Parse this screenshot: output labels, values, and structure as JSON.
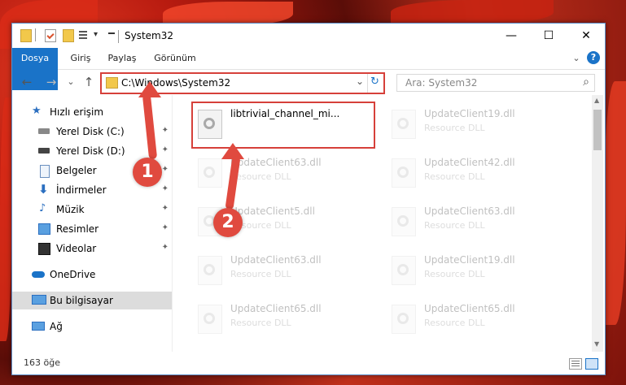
{
  "window": {
    "title": "System32",
    "minimize": "—",
    "maximize": "☐",
    "close": "✕"
  },
  "ribbon": {
    "tabs": [
      "Dosya",
      "Giriş",
      "Paylaş",
      "Görünüm"
    ],
    "chevron": "⌄",
    "help": "?"
  },
  "nav": {
    "back": "←",
    "forward": "→",
    "recent": "⌄",
    "up": "↑",
    "address": "C:\\Windows\\System32",
    "address_dropdown": "⌄",
    "refresh": "↻",
    "search_placeholder": "Ara: System32",
    "search_icon": "⌕"
  },
  "sidebar": {
    "items": [
      {
        "label": "Hızlı erişim",
        "pinned": false,
        "icon": "star-icon"
      },
      {
        "label": "Yerel Disk (C:)",
        "pinned": true,
        "icon": "drive-icon"
      },
      {
        "label": "Yerel Disk (D:)",
        "pinned": true,
        "icon": "drive-icon"
      },
      {
        "label": "Belgeler",
        "pinned": true,
        "icon": "document-icon"
      },
      {
        "label": "İndirmeler",
        "pinned": true,
        "icon": "download-icon"
      },
      {
        "label": "Müzik",
        "pinned": true,
        "icon": "music-icon"
      },
      {
        "label": "Resimler",
        "pinned": true,
        "icon": "pictures-icon"
      },
      {
        "label": "Videolar",
        "pinned": true,
        "icon": "video-icon"
      },
      {
        "label": "OneDrive",
        "pinned": false,
        "icon": "cloud-icon"
      },
      {
        "label": "Bu bilgisayar",
        "pinned": false,
        "icon": "computer-icon"
      },
      {
        "label": "Ağ",
        "pinned": false,
        "icon": "network-icon"
      }
    ],
    "pin_glyph": "📌"
  },
  "files": {
    "col1": [
      {
        "name": "libtrivial_channel_mi...",
        "sub": ""
      },
      {
        "name": "UpdateClient63.dll",
        "sub": "Resource DLL"
      },
      {
        "name": "UpdateClient5.dll",
        "sub": "Resource DLL"
      },
      {
        "name": "UpdateClient63.dll",
        "sub": "Resource DLL"
      },
      {
        "name": "UpdateClient65.dll",
        "sub": "Resource DLL"
      }
    ],
    "col2": [
      {
        "name": "UpdateClient19.dll",
        "sub": "Resource DLL"
      },
      {
        "name": "UpdateClient42.dll",
        "sub": "Resource DLL"
      },
      {
        "name": "UpdateClient63.dll",
        "sub": "Resource DLL"
      },
      {
        "name": "UpdateClient19.dll",
        "sub": "Resource DLL"
      },
      {
        "name": "UpdateClient65.dll",
        "sub": "Resource DLL"
      }
    ]
  },
  "status": {
    "count": "163 öğe"
  },
  "callouts": [
    "1",
    "2"
  ],
  "colors": {
    "accent": "#1a73c8",
    "highlight": "#d6403a"
  }
}
